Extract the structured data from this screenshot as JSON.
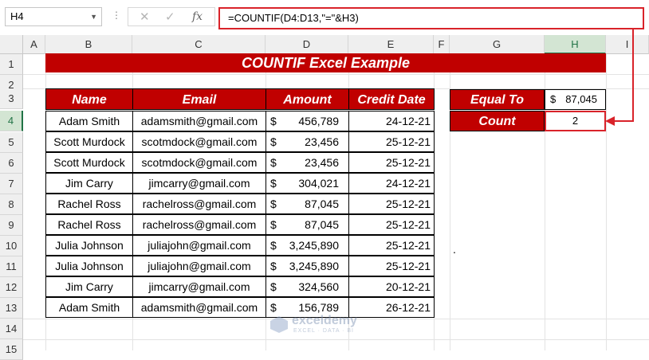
{
  "formula_bar": {
    "name_box": "H4",
    "formula": "=COUNTIF(D4:D13,\"=\"&H3)",
    "icons": [
      "chevron-down-icon",
      "close-icon",
      "check-icon",
      "fx-icon"
    ]
  },
  "columns": [
    "A",
    "B",
    "C",
    "D",
    "E",
    "F",
    "G",
    "H",
    "I"
  ],
  "rows": [
    "1",
    "2",
    "3",
    "4",
    "5",
    "6",
    "7",
    "8",
    "9",
    "10",
    "11",
    "12",
    "13",
    "14",
    "15"
  ],
  "title": "COUNTIF Excel Example",
  "table": {
    "headers": [
      "Name",
      "Email",
      "Amount",
      "Credit Date"
    ],
    "rows": [
      {
        "name": "Adam Smith",
        "email": "adamsmith@gmail.com",
        "cur": "$",
        "amount": "456,789",
        "date": "24-12-21"
      },
      {
        "name": "Scott Murdock",
        "email": "scotmdock@gmail.com",
        "cur": "$",
        "amount": "23,456",
        "date": "25-12-21"
      },
      {
        "name": "Scott Murdock",
        "email": "scotmdock@gmail.com",
        "cur": "$",
        "amount": "23,456",
        "date": "25-12-21"
      },
      {
        "name": "Jim Carry",
        "email": "jimcarry@gmail.com",
        "cur": "$",
        "amount": "304,021",
        "date": "24-12-21"
      },
      {
        "name": "Rachel Ross",
        "email": "rachelross@gmail.com",
        "cur": "$",
        "amount": "87,045",
        "date": "25-12-21"
      },
      {
        "name": "Rachel Ross",
        "email": "rachelross@gmail.com",
        "cur": "$",
        "amount": "87,045",
        "date": "25-12-21"
      },
      {
        "name": "Julia Johnson",
        "email": "juliajohn@gmail.com",
        "cur": "$",
        "amount": "3,245,890",
        "date": "25-12-21"
      },
      {
        "name": "Julia Johnson",
        "email": "juliajohn@gmail.com",
        "cur": "$",
        "amount": "3,245,890",
        "date": "25-12-21"
      },
      {
        "name": "Jim Carry",
        "email": "jimcarry@gmail.com",
        "cur": "$",
        "amount": "324,560",
        "date": "20-12-21"
      },
      {
        "name": "Adam Smith",
        "email": "adamsmith@gmail.com",
        "cur": "$",
        "amount": "156,789",
        "date": "26-12-21"
      }
    ]
  },
  "criteria": {
    "equal_label": "Equal To",
    "equal_cur": "$",
    "equal_value": "87,045",
    "count_label": "Count",
    "count_value": "2"
  },
  "stray_mark": ".",
  "watermark": {
    "name": "exceldemy",
    "tagline": "EXCEL · DATA · BI"
  },
  "colors": {
    "header_red": "#c00000",
    "highlight_red": "#d9232a",
    "selection_green": "#217346"
  }
}
